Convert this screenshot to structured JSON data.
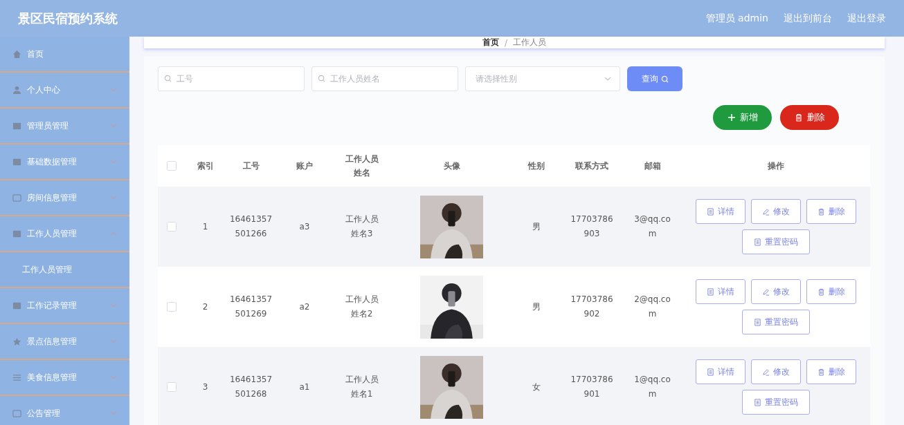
{
  "header": {
    "title": "景区民宿预约系统",
    "user": "管理员 admin",
    "links": [
      "退出到前台",
      "退出登录"
    ]
  },
  "sidebar": {
    "items": [
      {
        "label": "首页",
        "kind": "link",
        "selected": false
      },
      {
        "label": "个人中心",
        "kind": "menu",
        "expanded": false,
        "selected": false
      },
      {
        "label": "管理员管理",
        "kind": "menu",
        "expanded": false,
        "selected": false
      },
      {
        "label": "基础数据管理",
        "kind": "menu",
        "expanded": false,
        "selected": false
      },
      {
        "label": "房间信息管理",
        "kind": "menu",
        "expanded": false,
        "selected": false
      },
      {
        "label": "工作人员管理",
        "kind": "menu",
        "expanded": true,
        "selected": false,
        "children": [
          {
            "label": "工作人员管理",
            "selected": true
          }
        ]
      },
      {
        "label": "工作记录管理",
        "kind": "menu",
        "expanded": false,
        "selected": false
      },
      {
        "label": "景点信息管理",
        "kind": "menu",
        "expanded": false,
        "selected": false
      },
      {
        "label": "美食信息管理",
        "kind": "menu",
        "expanded": false,
        "selected": false
      },
      {
        "label": "公告管理",
        "kind": "menu",
        "expanded": false,
        "selected": false
      }
    ]
  },
  "breadcrumb": [
    "首页",
    "工作人员"
  ],
  "breadcrumb_separator": "/",
  "search": {
    "fields": [
      {
        "placeholder": "工号"
      },
      {
        "placeholder": "工作人员姓名"
      }
    ],
    "select": {
      "placeholder": "请选择性别"
    },
    "button": "查询"
  },
  "actions": [
    {
      "label": "新增",
      "kind": "add"
    },
    {
      "label": "删除",
      "kind": "delete"
    }
  ],
  "table": {
    "all_checked": false,
    "columns": [
      "索引",
      "工号",
      "账户",
      "工作人员姓名",
      "头像",
      "性别",
      "联系方式",
      "邮箱",
      "操作"
    ],
    "rows": [
      {
        "checked": false,
        "index": "1",
        "id": "16461357501266",
        "account": "a3",
        "name": "工作人员姓名3",
        "gender": "男",
        "phone": "17703786903",
        "email": "3@qq.com",
        "buttons": [
          {
            "label": "详情",
            "kind": "detail"
          },
          {
            "label": "修改",
            "kind": "edit"
          },
          {
            "label": "删除",
            "kind": "delete"
          },
          {
            "label": "重置密码",
            "kind": "reset"
          }
        ]
      },
      {
        "checked": false,
        "index": "2",
        "id": "16461357501269",
        "account": "a2",
        "name": "工作人员姓名2",
        "gender": "男",
        "phone": "17703786902",
        "email": "2@qq.com",
        "buttons": [
          {
            "label": "详情",
            "kind": "detail"
          },
          {
            "label": "修改",
            "kind": "edit"
          },
          {
            "label": "删除",
            "kind": "delete"
          },
          {
            "label": "重置密码",
            "kind": "reset"
          }
        ]
      },
      {
        "checked": false,
        "index": "3",
        "id": "16461357501268",
        "account": "a1",
        "name": "工作人员姓名1",
        "gender": "女",
        "phone": "17703786901",
        "email": "1@qq.com",
        "buttons": [
          {
            "label": "详情",
            "kind": "detail"
          },
          {
            "label": "修改",
            "kind": "edit"
          },
          {
            "label": "删除",
            "kind": "delete"
          },
          {
            "label": "重置密码",
            "kind": "reset"
          }
        ]
      }
    ]
  }
}
